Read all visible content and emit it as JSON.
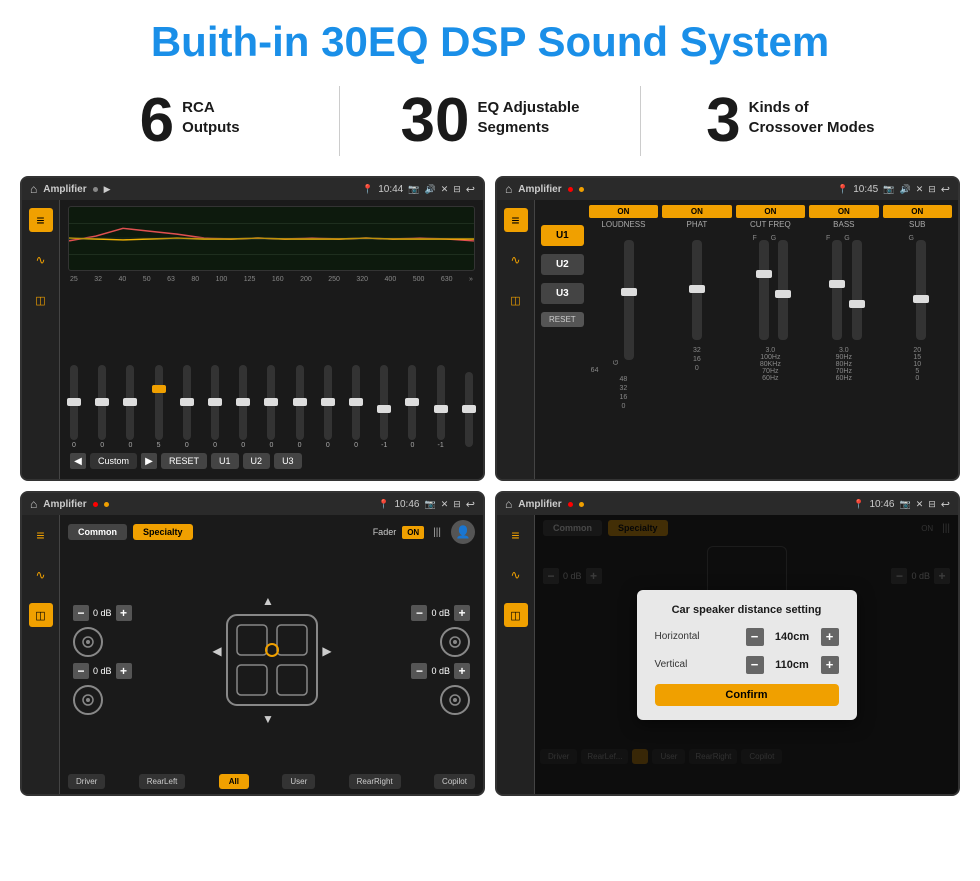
{
  "page": {
    "title": "Buith-in 30EQ DSP Sound System",
    "title_color": "#1a8fe8"
  },
  "stats": [
    {
      "number": "6",
      "label": "RCA\nOutputs"
    },
    {
      "number": "30",
      "label": "EQ Adjustable\nSegments"
    },
    {
      "number": "3",
      "label": "Kinds of\nCrossover Modes"
    }
  ],
  "screens": [
    {
      "id": "screen1",
      "title": "Amplifier",
      "time": "10:44",
      "type": "eq"
    },
    {
      "id": "screen2",
      "title": "Amplifier",
      "time": "10:45",
      "type": "crossover"
    },
    {
      "id": "screen3",
      "title": "Amplifier",
      "time": "10:46",
      "type": "fader"
    },
    {
      "id": "screen4",
      "title": "Amplifier",
      "time": "10:46",
      "type": "distance"
    }
  ],
  "eq": {
    "frequencies": [
      "25",
      "32",
      "40",
      "50",
      "63",
      "80",
      "100",
      "125",
      "160",
      "200",
      "250",
      "320",
      "400",
      "500",
      "630"
    ],
    "values": [
      "0",
      "0",
      "0",
      "5",
      "0",
      "0",
      "0",
      "0",
      "0",
      "0",
      "0",
      "-1",
      "0",
      "-1",
      ""
    ],
    "presets": [
      "Custom",
      "RESET",
      "U1",
      "U2",
      "U3"
    ]
  },
  "crossover": {
    "units": [
      "U1",
      "U2",
      "U3"
    ],
    "channels": [
      {
        "name": "LOUDNESS",
        "on": true
      },
      {
        "name": "PHAT",
        "on": true
      },
      {
        "name": "CUT FREQ",
        "on": true
      },
      {
        "name": "BASS",
        "on": true
      },
      {
        "name": "SUB",
        "on": true
      }
    ]
  },
  "fader": {
    "tabs": [
      "Common",
      "Specialty"
    ],
    "active_tab": "Specialty",
    "label": "Fader",
    "on": true,
    "db_values": [
      "0 dB",
      "0 dB",
      "0 dB",
      "0 dB"
    ],
    "buttons": [
      "Driver",
      "RearLeft",
      "All",
      "User",
      "RearRight",
      "Copilot"
    ]
  },
  "distance": {
    "dialog_title": "Car speaker distance setting",
    "horizontal_label": "Horizontal",
    "horizontal_value": "140cm",
    "vertical_label": "Vertical",
    "vertical_value": "110cm",
    "confirm_label": "Confirm",
    "tabs": [
      "Common",
      "Specialty"
    ],
    "db_values": [
      "0 dB",
      "0 dB"
    ]
  }
}
